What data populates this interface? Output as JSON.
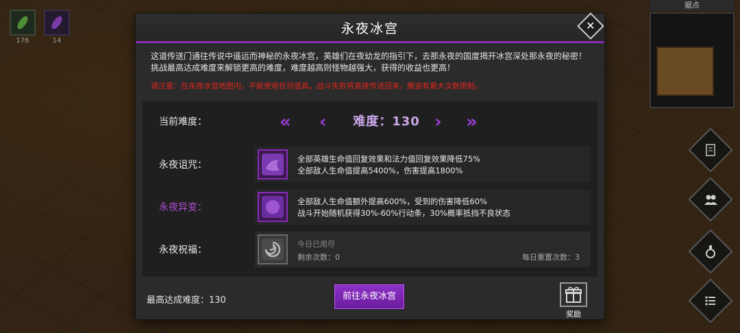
{
  "hud": {
    "slots": [
      {
        "count": "176",
        "icon": "green-gem-icon",
        "color": "#5aa040"
      },
      {
        "count": "14",
        "icon": "purple-gem-icon",
        "color": "#8a40b8"
      }
    ],
    "minimap_title": "据点"
  },
  "panel": {
    "title": "永夜冰宫",
    "close_icon": "close-icon",
    "description_line1": "这道传送门通往传说中遥远而神秘的永夜冰宫，英雄们在夜幼龙的指引下，去那永夜的国度揭开冰宫深处那永夜的秘密！",
    "description_line2": "挑战最高达成难度来解锁更高的难度，难度越高则怪物越强大，获得的收益也更高！",
    "warning": "请注意：在永夜冰宫地图内，不能使用任何道具。战斗失败将直接传送回来，撤退有最大次数限制。",
    "difficulty": {
      "label": "当前难度：",
      "value_text": "难度：130",
      "first_arrow": "«",
      "prev_arrow": "‹",
      "next_arrow": "›",
      "last_arrow": "»"
    },
    "curse": {
      "label": "永夜诅咒：",
      "icon": "purple-curse-icon",
      "line1": "全部英雄生命值回复效果和法力值回复效果降低75%",
      "line2": "全部敌人生命值提高5400%，伤害提高1800%"
    },
    "mutation": {
      "label": "永夜异变：",
      "icon": "purple-mutation-icon",
      "line1": "全部敌人生命值额外提高600%，受到的伤害降低60%",
      "line2": "战斗开始随机获得30%-60%行动条，30%概率抵挡不良状态"
    },
    "blessing": {
      "label": "永夜祝福：",
      "icon": "swirl-blessing-icon",
      "status": "今日已用尽",
      "remaining": "剩余次数：0",
      "daily_reset": "每日重置次数：3"
    },
    "footer": {
      "max_difficulty": "最高达成难度：130",
      "go_button": "前往永夜冰宫",
      "reward_label": "奖励",
      "reward_icon": "gift-icon"
    }
  },
  "colors": {
    "accent": "#8a2bb8",
    "warning": "#e0261e",
    "mutation_label": "#b24fd8"
  }
}
